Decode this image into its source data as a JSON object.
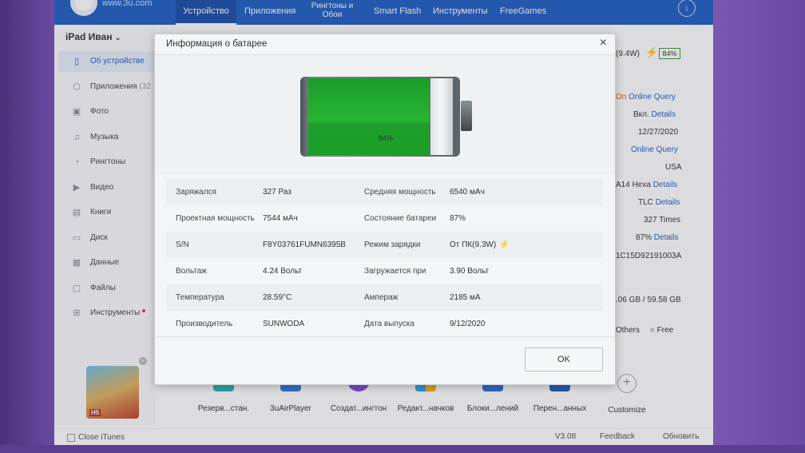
{
  "topbar": {
    "logo_text": "www.3u.com",
    "tabs": [
      "Устройство",
      "Приложения",
      "Рингтоны и Обои",
      "Smart Flash",
      "Инструменты",
      "FreeGames"
    ]
  },
  "sidebar": {
    "device_name": "iPad Иван",
    "items": [
      {
        "label": "Об устройстве",
        "icon": "tablet-icon"
      },
      {
        "label": "Приложения",
        "count": "(32",
        "icon": "cube-icon"
      },
      {
        "label": "Фото",
        "icon": "image-icon"
      },
      {
        "label": "Музыка",
        "icon": "music-icon"
      },
      {
        "label": "Рингтоны",
        "icon": "bell-icon"
      },
      {
        "label": "Видео",
        "icon": "play-icon"
      },
      {
        "label": "Книги",
        "icon": "book-icon"
      },
      {
        "label": "Диск",
        "icon": "usb-icon"
      },
      {
        "label": "Данные",
        "icon": "data-icon"
      },
      {
        "label": "Файлы",
        "icon": "folder-icon"
      },
      {
        "label": "Инструменты",
        "icon": "grid-icon"
      }
    ]
  },
  "background_info": {
    "power": "(9.4W)",
    "battery_pct": "84%",
    "row1_status": "On",
    "row1_link": "Online Query",
    "row2_value": "Вкл.",
    "row2_link": "Details",
    "row3_value": "12/27/2020",
    "row4_link": "Online Query",
    "row5_value": "USA",
    "row6_value": "A14 Hexa",
    "row6_link": "Details",
    "row7_value": "TLC",
    "row7_link": "Details",
    "row8_value": "327 Times",
    "row9_value": "87%",
    "row9_link": "Details",
    "row10_value": "1C15D92191003A",
    "storage": ".06 GB / 59.58 GB",
    "legend_others": "Others",
    "legend_free": "Free"
  },
  "toolbar": {
    "items": [
      "Резерв...стан.",
      "3uAirPlayer",
      "Создат...ингтон",
      "Редакт...начков",
      "Блоки...лений",
      "Перен...анных",
      "Customize"
    ]
  },
  "statusbar": {
    "close_itunes": "Close iTunes",
    "version": "V3.08",
    "feedback": "Feedback",
    "update": "Обновить"
  },
  "modal": {
    "title": "Информация о батарее",
    "close": "×",
    "battery_level": 0.84,
    "battery_label": "84%",
    "ok": "OK",
    "rows": [
      {
        "l1": "Заряжался",
        "v1": "327 Раз",
        "l2": "Средняя мощность",
        "v2": "6540 мАч"
      },
      {
        "l1": "Проектная мощность",
        "v1": "7544 мАч",
        "l2": "Состояние батареи",
        "v2": "87%"
      },
      {
        "l1": "S/N",
        "v1": "F8Y03761FUMN6395B",
        "l2": "Режим зарядки",
        "v2": "От ПК(9.3W)"
      },
      {
        "l1": "Вольтаж",
        "v1": "4.24 Вольт",
        "l2": "Загружается при",
        "v2": "3.90 Вольт"
      },
      {
        "l1": "Температура",
        "v1": "28.59°C",
        "l2": "Ампераж",
        "v2": "2185 мА"
      },
      {
        "l1": "Производитель",
        "v1": "SUNWODA",
        "l2": "Дата выпуска",
        "v2": "9/12/2020"
      }
    ]
  }
}
